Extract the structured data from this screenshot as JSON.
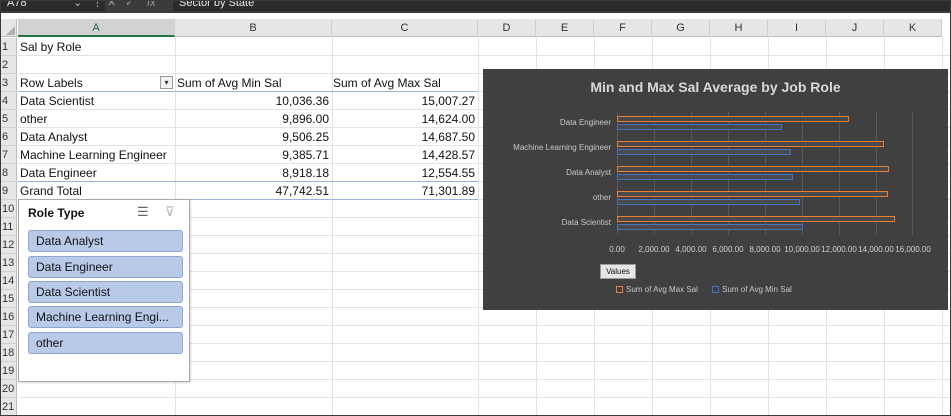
{
  "formula_bar": {
    "name_box": "A78",
    "fx_label": "fx",
    "content": "Sector by State"
  },
  "columns": [
    "A",
    "B",
    "C",
    "D",
    "E",
    "F",
    "G",
    "H",
    "I",
    "J",
    "K"
  ],
  "rows": [
    "1",
    "2",
    "3",
    "4",
    "5",
    "6",
    "7",
    "8",
    "9",
    "10",
    "11",
    "12",
    "13",
    "14",
    "15",
    "16",
    "17",
    "18",
    "19",
    "20",
    "21"
  ],
  "sheet": {
    "title": "Sal by Role",
    "headers": [
      "Row Labels",
      "Sum of Avg Min Sal",
      "Sum of Avg Max Sal"
    ],
    "rows": [
      {
        "label": "Data Scientist",
        "min": "10,036.36",
        "max": "15,007.27"
      },
      {
        "label": "other",
        "min": "9,896.00",
        "max": "14,624.00"
      },
      {
        "label": "Data Analyst",
        "min": "9,506.25",
        "max": "14,687.50"
      },
      {
        "label": "Machine Learning Engineer",
        "min": "9,385.71",
        "max": "14,428.57"
      },
      {
        "label": "Data Engineer",
        "min": "8,918.18",
        "max": "12,554.55"
      }
    ],
    "grand_total": {
      "label": "Grand Total",
      "min": "47,742.51",
      "max": "71,301.89"
    }
  },
  "slicer": {
    "title": "Role Type",
    "multiselect_icon": "multi-select-icon",
    "clear_filter_icon": "clear-filter-icon",
    "items": [
      "Data Analyst",
      "Data Engineer",
      "Data Scientist",
      "Machine Learning Engi...",
      "other"
    ]
  },
  "chart_data": {
    "type": "bar",
    "orientation": "horizontal",
    "title": "Min and Max Sal Average by Job Role",
    "categories": [
      "Data Engineer",
      "Machine Learning Engineer",
      "Data Analyst",
      "other",
      "Data Scientist"
    ],
    "series": [
      {
        "name": "Sum of Avg Max Sal",
        "color": "#ed7d31",
        "values": [
          12554.55,
          14428.57,
          14687.5,
          14624.0,
          15007.27
        ]
      },
      {
        "name": "Sum of Avg Min Sal",
        "color": "#4472c4",
        "values": [
          8918.18,
          9385.71,
          9506.25,
          9896.0,
          10036.36
        ]
      }
    ],
    "x_ticks": [
      "0.00",
      "2,000.00",
      "4,000.00",
      "6,000.00",
      "8,000.00",
      "10,000.00",
      "12,000.00",
      "14,000.00",
      "16,000.00"
    ],
    "xlim": [
      0,
      16000
    ],
    "field_button": "Values",
    "legend_position": "bottom",
    "background": "#404040"
  }
}
